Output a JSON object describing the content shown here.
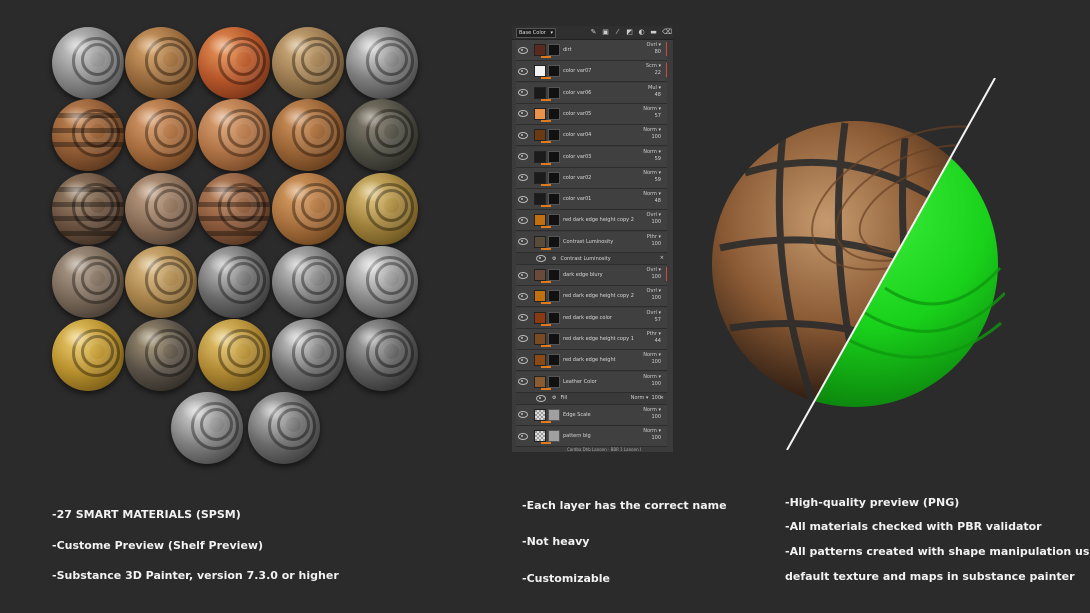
{
  "materials": {
    "spheres": [
      {
        "id": "m01",
        "base": "#8a8a8a",
        "dark": "#3a3a3a",
        "light": "#d0d0d0",
        "bands": 0
      },
      {
        "id": "m02",
        "base": "#9a6c3e",
        "dark": "#4b2e14",
        "light": "#d9a56a",
        "bands": 0
      },
      {
        "id": "m03",
        "base": "#b5562a",
        "dark": "#5a2410",
        "light": "#ec9a5c",
        "bands": 0
      },
      {
        "id": "m04",
        "base": "#9a7a50",
        "dark": "#4d3a20",
        "light": "#d6b280",
        "bands": 0
      },
      {
        "id": "m05",
        "base": "#7c7c7c",
        "dark": "#2c2c2c",
        "light": "#d9d9d9",
        "bands": 0
      },
      {
        "id": "m06",
        "base": "#8f5b34",
        "dark": "#3e2412",
        "light": "#c88a58",
        "bands": 3
      },
      {
        "id": "m07",
        "base": "#a66c3e",
        "dark": "#4e2c12",
        "light": "#dca070",
        "bands": 0
      },
      {
        "id": "m08",
        "base": "#b07447",
        "dark": "#5a3216",
        "light": "#e1a778",
        "bands": 0
      },
      {
        "id": "m09",
        "base": "#9a6436",
        "dark": "#4a2a10",
        "light": "#d49660",
        "bands": 0
      },
      {
        "id": "m10",
        "base": "#4f4f45",
        "dark": "#1c1c18",
        "light": "#8a8070",
        "bands": 0
      },
      {
        "id": "m11",
        "base": "#6a5240",
        "dark": "#2a1e14",
        "light": "#a48a70",
        "bands": 4
      },
      {
        "id": "m12",
        "base": "#8a6e58",
        "dark": "#3a2c20",
        "light": "#c4a488",
        "bands": 0
      },
      {
        "id": "m13",
        "base": "#8a5a3c",
        "dark": "#3c2414",
        "light": "#c28c66",
        "bands": 4
      },
      {
        "id": "m14",
        "base": "#a8703e",
        "dark": "#50300e",
        "light": "#dca266",
        "bands": 0
      },
      {
        "id": "m15",
        "base": "#a0823c",
        "dark": "#4e3c12",
        "light": "#e2c47a",
        "bands": 0
      },
      {
        "id": "m16",
        "base": "#7a6a5a",
        "dark": "#2e2620",
        "light": "#b4a290",
        "bands": 0
      },
      {
        "id": "m17",
        "base": "#a8844c",
        "dark": "#54401c",
        "light": "#e0c088",
        "bands": 0
      },
      {
        "id": "m18",
        "base": "#6a6a6a",
        "dark": "#222222",
        "light": "#c4c4c4",
        "bands": 0
      },
      {
        "id": "m19",
        "base": "#787878",
        "dark": "#2a2a2a",
        "light": "#cccccc",
        "bands": 0
      },
      {
        "id": "m20",
        "base": "#8a8a8a",
        "dark": "#333333",
        "light": "#e0e0e0",
        "bands": 0
      },
      {
        "id": "m21",
        "base": "#b8902e",
        "dark": "#5a420c",
        "light": "#f0d070",
        "bands": 0
      },
      {
        "id": "m22",
        "base": "#5a5248",
        "dark": "#1e1a16",
        "light": "#a89878",
        "bands": 0
      },
      {
        "id": "m23",
        "base": "#b08a34",
        "dark": "#56400e",
        "light": "#eacb74",
        "bands": 0
      },
      {
        "id": "m24",
        "base": "#707070",
        "dark": "#262626",
        "light": "#d4d4d4",
        "bands": 0
      },
      {
        "id": "m25",
        "base": "#5e5e5e",
        "dark": "#1e1e1e",
        "light": "#b0b0b0",
        "bands": 0
      },
      {
        "id": "m26",
        "base": "#808080",
        "dark": "#2e2e2e",
        "light": "#d6d6d6",
        "bands": 0
      },
      {
        "id": "m27",
        "base": "#6c6c6c",
        "dark": "#262626",
        "light": "#c0c0c0",
        "bands": 0
      }
    ]
  },
  "panel": {
    "channel": "Base Color",
    "layers": [
      {
        "name": "dirt",
        "mode": "Ovrl",
        "opacity": "80",
        "thumb": "#5a2a1e",
        "kind": "layer",
        "red": true
      },
      {
        "name": "color var07",
        "mode": "Scrn",
        "opacity": "22",
        "thumb": "#f2f2f2",
        "kind": "layer",
        "red": true
      },
      {
        "name": "color var06",
        "mode": "Mul",
        "opacity": "48",
        "thumb": "#1a1a1a",
        "kind": "layer"
      },
      {
        "name": "color var05",
        "mode": "Norm",
        "opacity": "57",
        "thumb": "#e8924a",
        "kind": "layer"
      },
      {
        "name": "color var04",
        "mode": "Norm",
        "opacity": "100",
        "thumb": "#6a3a12",
        "kind": "layer"
      },
      {
        "name": "color var03",
        "mode": "Norm",
        "opacity": "59",
        "thumb": "#1c1c1c",
        "kind": "layer"
      },
      {
        "name": "color var02",
        "mode": "Norm",
        "opacity": "59",
        "thumb": "#1c1c1c",
        "kind": "layer"
      },
      {
        "name": "color var01",
        "mode": "Norm",
        "opacity": "48",
        "thumb": "#1c1c1c",
        "kind": "layer"
      },
      {
        "name": "red dark edge height copy 2",
        "mode": "Ovrl",
        "opacity": "100",
        "thumb": "#c07010",
        "kind": "layer"
      },
      {
        "name": "Contrast Luminosity",
        "mode": "Pthr",
        "opacity": "100",
        "thumb": "#5a4a3a",
        "kind": "folder"
      },
      {
        "name": "Contrast Luminosity",
        "mode": "",
        "opacity": "",
        "thumb": "",
        "kind": "effect"
      },
      {
        "name": "dark edge blury",
        "mode": "Ovrl",
        "opacity": "100",
        "thumb": "#6a4a3a",
        "kind": "layer",
        "red": true
      },
      {
        "name": "red dark edge height copy 2",
        "mode": "Ovrl",
        "opacity": "100",
        "thumb": "#c07010",
        "kind": "layer"
      },
      {
        "name": "red dark edge color",
        "mode": "Ovrl",
        "opacity": "57",
        "thumb": "#8a3a12",
        "kind": "layer"
      },
      {
        "name": "red dark edge height copy 1",
        "mode": "Pthr",
        "opacity": "44",
        "thumb": "#7a4a22",
        "kind": "layer"
      },
      {
        "name": "red dark edge height",
        "mode": "Norm",
        "opacity": "100",
        "thumb": "#8a4a16",
        "kind": "layer"
      },
      {
        "name": "Leather Color",
        "mode": "Norm",
        "opacity": "100",
        "thumb": "#8a5a30",
        "kind": "folder"
      },
      {
        "name": "Fill",
        "mode": "Norm",
        "opacity": "100",
        "thumb": "",
        "kind": "effect"
      },
      {
        "name": "Edge Scale",
        "mode": "Norm",
        "opacity": "100",
        "thumb": "#bdbdbd",
        "kind": "layer"
      },
      {
        "name": "pattern big",
        "mode": "Norm",
        "opacity": "100",
        "thumb": "#bdbdbd",
        "kind": "layer"
      }
    ],
    "footer": "Cardba Dhb Lanonn · BBR 1 Lanonn I"
  },
  "colors": {
    "background": "#2b2b2b",
    "accent_green": "#19d11a",
    "accent_orange": "#e07a1d"
  },
  "features": {
    "col1": [
      "-27 SMART MATERIALS (SPSM)",
      "-Custome Preview (Shelf Preview)",
      "-Substance 3D Painter, version 7.3.0 or higher"
    ],
    "col2": [
      "-Each layer has the correct name",
      "-Not heavy",
      "-Customizable"
    ],
    "col3": [
      "-High-quality preview (PNG)",
      "-All materials checked with PBR validator",
      "-All patterns created with shape manipulation using",
      "default texture and maps in substance painter"
    ]
  }
}
